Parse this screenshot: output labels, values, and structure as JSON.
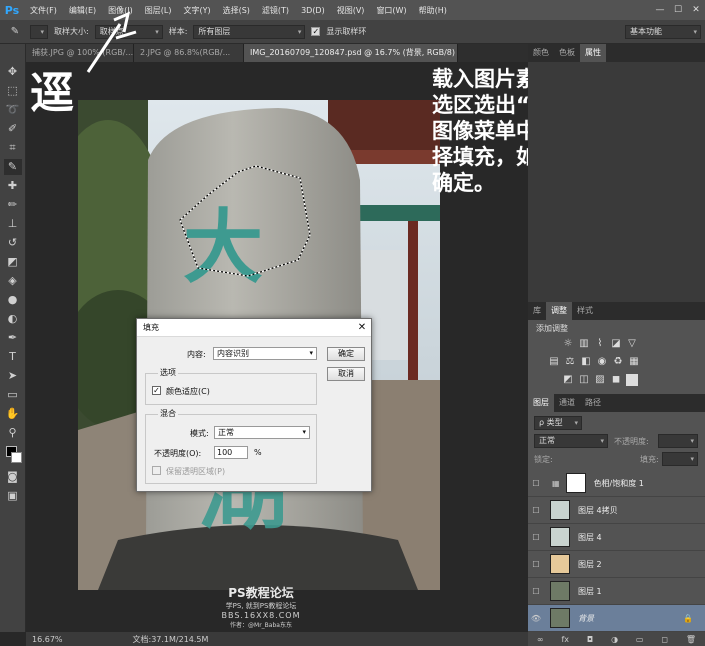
{
  "app": {
    "logo": "Ps",
    "menu": [
      "文件(F)",
      "编辑(E)",
      "图像(I)",
      "图层(L)",
      "文字(Y)",
      "选择(S)",
      "滤镜(T)",
      "3D(D)",
      "视图(V)",
      "窗口(W)",
      "帮助(H)"
    ],
    "window_controls": [
      "—",
      "☐",
      "✕"
    ]
  },
  "options": {
    "sample_size_label": "取样大小:",
    "sample_size_value": "取样点",
    "sample_label": "样本:",
    "sample_value": "所有图层",
    "show_ring_label": "显示取样环",
    "workspace": "基本功能"
  },
  "tabs": [
    {
      "label": "捕获.JPG @ 100% (RGB/...",
      "close": "×"
    },
    {
      "label": "2.JPG @ 86.8%(RGB/...",
      "close": "×"
    },
    {
      "label": "IMG_20160709_120847.psd @ 16.7% (背景, RGB/8) *",
      "close": "×"
    }
  ],
  "annotation": {
    "left_text": "逕",
    "lines": [
      "载入图片素材，",
      "选区选出“大”字",
      "图像菜单中，选",
      "择填充，如图按",
      "确定。"
    ]
  },
  "stone": {
    "char_top": "大",
    "char_bottom": "湖"
  },
  "watermark": {
    "title": "PS教程论坛",
    "line2": "学PS, 就到PS教程论坛",
    "line3": "BBS.16XX8.COM",
    "line4": "作者：@Mr_Baba东东"
  },
  "dialog": {
    "title": "填充",
    "content_label": "内容:",
    "content_value": "内容识别",
    "ok": "确定",
    "cancel": "取消",
    "options_group": "选项",
    "color_adapt": "颜色适应(C)",
    "blend_group": "混合",
    "mode_label": "模式:",
    "mode_value": "正常",
    "opacity_label": "不透明度(O):",
    "opacity_value": "100",
    "opacity_unit": "%",
    "preserve": "保留透明区域(P)"
  },
  "color_panel": {
    "tabs": [
      "颜色",
      "色板",
      "属性"
    ]
  },
  "adj_panel": {
    "tabs": [
      "库",
      "调整",
      "样式"
    ],
    "title": "添加调整"
  },
  "layers_panel": {
    "tabs": [
      "图层",
      "通道",
      "路径"
    ],
    "filter_label": "ρ 类型",
    "blend_mode": "正常",
    "opacity_label": "不透明度:",
    "lock_label": "锁定:",
    "fill_label": "填充:",
    "layers": [
      "色相/饱和度 1",
      "图层 4拷贝",
      "图层 4",
      "图层 2",
      "图层 1",
      "背景"
    ]
  },
  "status": {
    "zoom": "16.67%",
    "doc": "文档:37.1M/214.5M"
  }
}
